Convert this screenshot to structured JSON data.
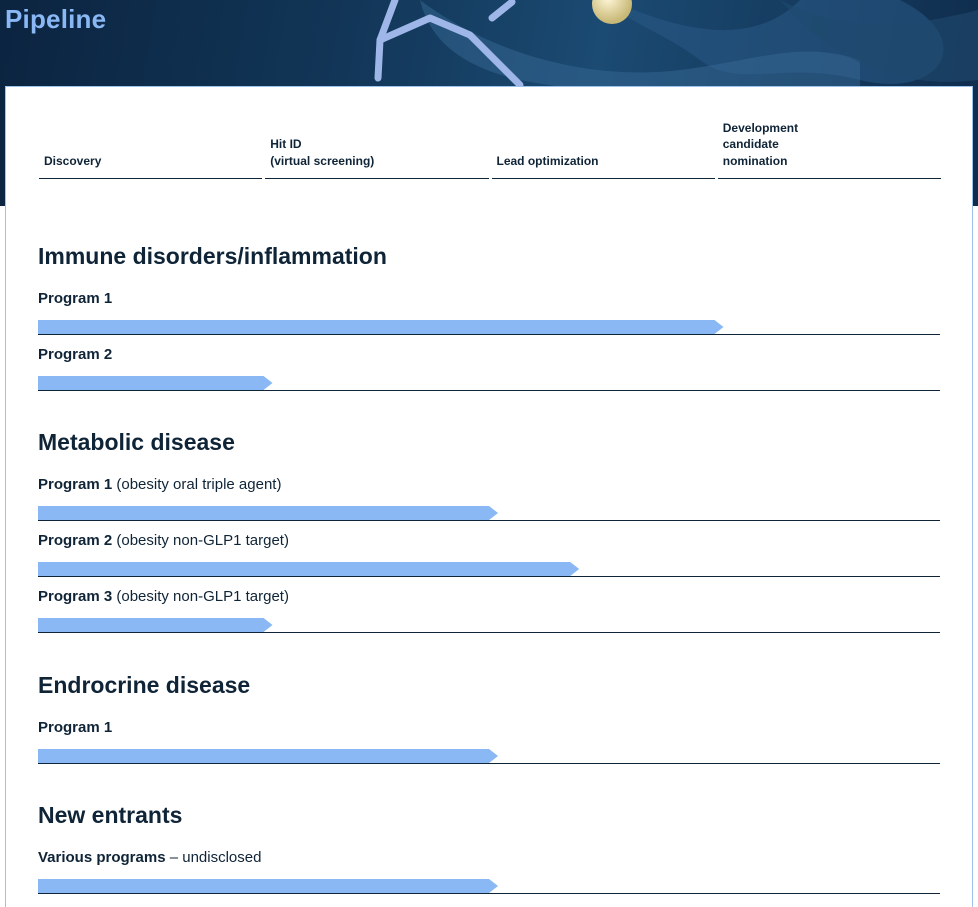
{
  "page": {
    "title": "Pipeline"
  },
  "stages": [
    {
      "label": "Discovery"
    },
    {
      "label": "Hit ID\n(virtual screening)"
    },
    {
      "label": "Lead optimization"
    },
    {
      "label": "Development\ncandidate\nnomination"
    }
  ],
  "colors": {
    "accent": "#8ab8f5",
    "text": "#0f2437",
    "banner": "#123658"
  },
  "sections": [
    {
      "title": "Immune disorders/inflammation",
      "programs": [
        {
          "name": "Program 1",
          "detail": "",
          "progress": 0.76
        },
        {
          "name": "Program 2",
          "detail": "",
          "progress": 0.26
        }
      ]
    },
    {
      "title": "Metabolic disease",
      "programs": [
        {
          "name": "Program 1",
          "detail": " (obesity oral triple agent)",
          "progress": 0.51
        },
        {
          "name": "Program 2",
          "detail": " (obesity non-GLP1 target)",
          "progress": 0.6
        },
        {
          "name": "Program 3",
          "detail": " (obesity non-GLP1 target)",
          "progress": 0.26
        }
      ]
    },
    {
      "title": "Endrocrine disease",
      "programs": [
        {
          "name": "Program 1",
          "detail": "",
          "progress": 0.51
        }
      ]
    },
    {
      "title": "New entrants",
      "programs": [
        {
          "name": "Various programs",
          "detail": " – undisclosed",
          "progress": 0.51
        }
      ]
    }
  ]
}
